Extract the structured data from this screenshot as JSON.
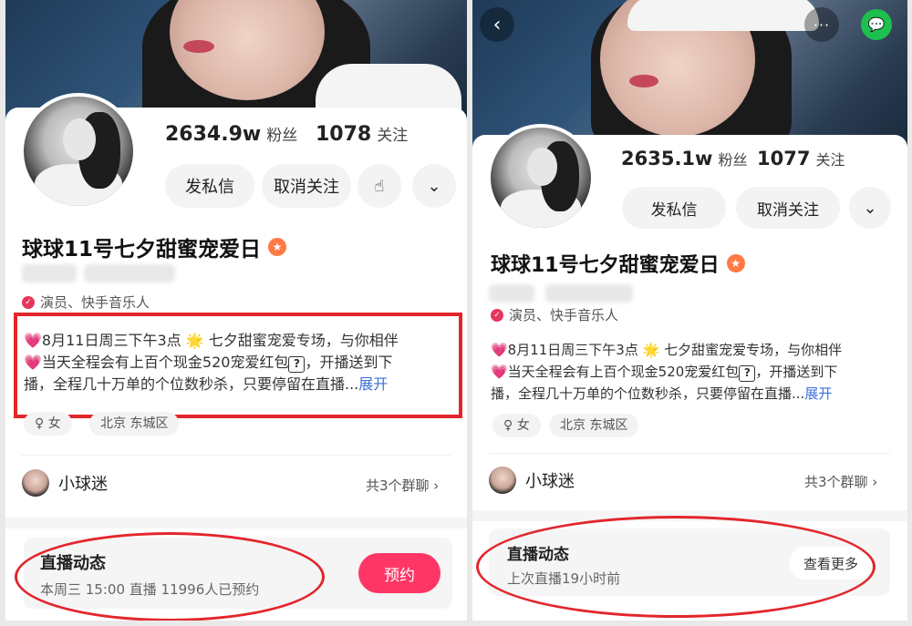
{
  "left": {
    "fans": "2634.9w",
    "fans_label": "粉丝",
    "following": "1078",
    "following_label": "关注",
    "message_button": "发私信",
    "unfollow_button": "取消关注",
    "name": "球球11号七夕甜蜜宠爱日",
    "certification": "演员、快手音乐人",
    "bio_line1": "💗8月11日周三下午3点 🌟 七夕甜蜜宠爱专场，与你相伴",
    "bio_line2a": "💗当天全程会有上百个现金520宠爱红包",
    "bio_q": "?",
    "bio_line2b": "，开播送到下",
    "bio_line3": "播，全程几十万单的个位数秒杀，只要停留在直播...",
    "bio_more": "展开",
    "gender": "女",
    "location": "北京 东城区",
    "fan_club": "小球迷",
    "groups": "共3个群聊 ›",
    "live_title": "直播动态",
    "live_subtitle": "本周三 15:00 直播 11996人已预约",
    "reserve_button": "预约"
  },
  "right": {
    "fans": "2635.1w",
    "fans_label": "粉丝",
    "following": "1077",
    "following_label": "关注",
    "message_button": "发私信",
    "unfollow_button": "取消关注",
    "name": "球球11号七夕甜蜜宠爱日",
    "certification": "演员、快手音乐人",
    "bio_line1": "💗8月11日周三下午3点 🌟 七夕甜蜜宠爱专场，与你相伴",
    "bio_line2a": "💗当天全程会有上百个现金520宠爱红包",
    "bio_q": "?",
    "bio_line2b": "，开播送到下",
    "bio_line3": "播，全程几十万单的个位数秒杀，只要停留在直播...",
    "bio_more": "展开",
    "gender": "女",
    "location": "北京 东城区",
    "fan_club": "小球迷",
    "groups": "共3个群聊 ›",
    "live_title": "直播动态",
    "live_subtitle": "上次直播19小时前",
    "more_button": "查看更多"
  },
  "icons": {
    "back": "‹",
    "more": "···",
    "wechat": "💬",
    "touch": "☝",
    "chevron": "⌄",
    "badge": "★",
    "verified": "✓",
    "female": "♀"
  },
  "colors": {
    "accent_pink": "#fe3666",
    "highlight_red": "#e3262c",
    "link_blue": "#3a6fd8",
    "badge_orange": "#ff7a45"
  }
}
